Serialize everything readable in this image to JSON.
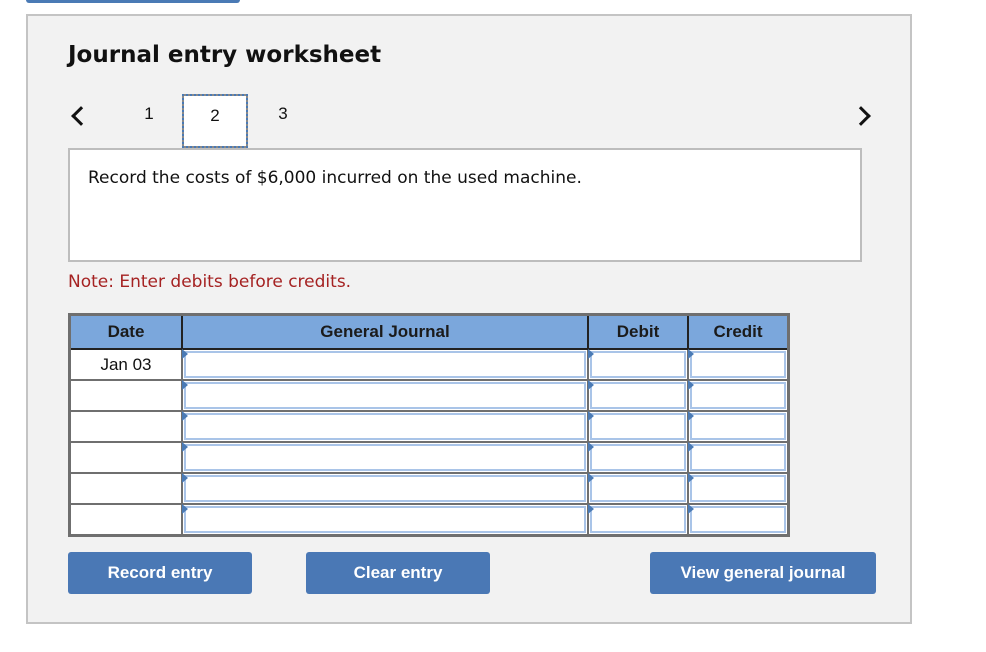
{
  "worksheet": {
    "title": "Journal entry worksheet",
    "steps": [
      "1",
      "2",
      "3"
    ],
    "active_step": "2",
    "prompt": "Record the costs of $6,000 incurred on the used machine.",
    "note": "Note: Enter debits before credits."
  },
  "journal": {
    "headers": {
      "date": "Date",
      "general_journal": "General Journal",
      "debit": "Debit",
      "credit": "Credit"
    },
    "rows": [
      {
        "date": "Jan 03",
        "account": "",
        "debit": "",
        "credit": ""
      },
      {
        "date": "",
        "account": "",
        "debit": "",
        "credit": ""
      },
      {
        "date": "",
        "account": "",
        "debit": "",
        "credit": ""
      },
      {
        "date": "",
        "account": "",
        "debit": "",
        "credit": ""
      },
      {
        "date": "",
        "account": "",
        "debit": "",
        "credit": ""
      },
      {
        "date": "",
        "account": "",
        "debit": "",
        "credit": ""
      }
    ]
  },
  "buttons": {
    "record": "Record entry",
    "clear": "Clear entry",
    "view": "View general journal"
  },
  "colors": {
    "accent": "#4a78b5",
    "header": "#7ba7dc",
    "note": "#a52222"
  }
}
